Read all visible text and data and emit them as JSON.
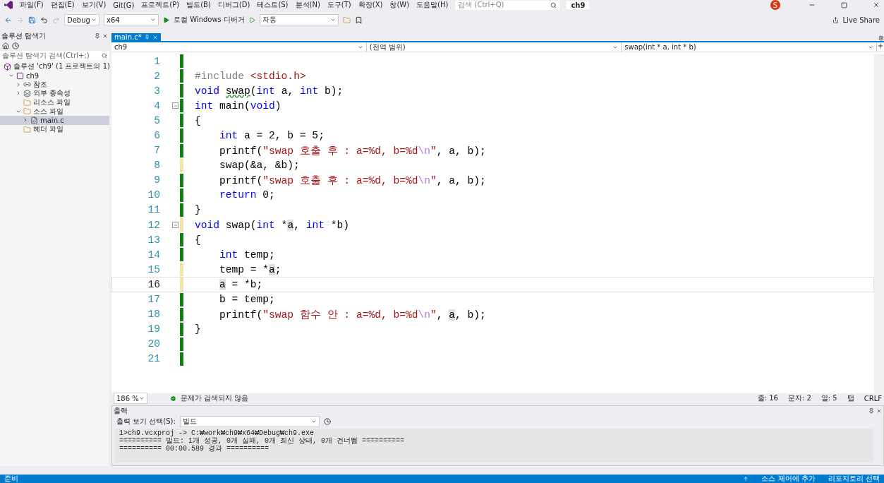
{
  "menu": [
    "파일(F)",
    "편집(E)",
    "보기(V)",
    "Git(G)",
    "프로젝트(P)",
    "빌드(B)",
    "디버그(D)",
    "테스트(S)",
    "분석(N)",
    "도구(T)",
    "확장(X)",
    "창(W)",
    "도움말(H)"
  ],
  "search": {
    "placeholder": "검색 (Ctrl+Q)"
  },
  "solution_name": "ch9",
  "avatar": "S",
  "toolbar": {
    "configuration": "Debug",
    "platform": "x64",
    "run_label": "로컬 Windows 디버거",
    "solution_config": "자동",
    "live_share": "Live Share"
  },
  "solution_explorer": {
    "title": "솔루션 탐색기",
    "search_placeholder": "솔루션 탐색기 검색(Ctrl+;)",
    "tree": [
      {
        "label": "솔루션 'ch9' (1 프로젝트의 1)",
        "kind": "solution",
        "selected": false,
        "children": [
          {
            "label": "ch9",
            "kind": "project",
            "expanded": true,
            "selected": false,
            "children": [
              {
                "label": "참조",
                "kind": "refs",
                "expanded": false,
                "selected": false
              },
              {
                "label": "외부 종속성",
                "kind": "deps",
                "expanded": false,
                "selected": false
              },
              {
                "label": "리소스 파일",
                "kind": "folder",
                "selected": false
              },
              {
                "label": "소스 파일",
                "kind": "folder",
                "expanded": true,
                "selected": false,
                "children": [
                  {
                    "label": "main.c",
                    "kind": "file",
                    "expanded": false,
                    "selected": true
                  }
                ]
              },
              {
                "label": "헤더 파일",
                "kind": "folder",
                "selected": false
              }
            ]
          }
        ]
      }
    ]
  },
  "editor": {
    "tab": "main.c*",
    "nav": [
      "ch9",
      "(전역 범위)",
      "swap(int * a, int * b)"
    ],
    "lines": [
      {
        "number": "1",
        "modified": false,
        "current": false,
        "fold": false
      },
      {
        "number": "2",
        "modified": false,
        "current": false,
        "fold": false,
        "indented": false,
        "tokens": [
          {
            "kind": "pp",
            "text": "#include "
          },
          {
            "kind": "string",
            "text": "<stdio.h>"
          }
        ]
      },
      {
        "number": "3",
        "modified": false,
        "current": false,
        "fold": false,
        "indented": false,
        "tokens": [
          {
            "kind": "keyword",
            "text": "void "
          },
          {
            "kind": "warn",
            "text": "swap"
          },
          {
            "kind": "plain",
            "text": "("
          },
          {
            "kind": "keyword",
            "text": "int"
          },
          {
            "kind": "plain",
            "text": " a, "
          },
          {
            "kind": "keyword",
            "text": "int"
          },
          {
            "kind": "plain",
            "text": " b);"
          }
        ]
      },
      {
        "number": "4",
        "modified": false,
        "current": false,
        "fold": true,
        "indented": false,
        "tokens": [
          {
            "kind": "keyword",
            "text": "int"
          },
          {
            "kind": "plain",
            "text": " main("
          },
          {
            "kind": "keyword",
            "text": "void"
          },
          {
            "kind": "plain",
            "text": ")"
          }
        ]
      },
      {
        "number": "5",
        "modified": false,
        "current": false,
        "fold": false,
        "indented": false,
        "tokens": [
          {
            "kind": "plain",
            "text": "{"
          }
        ]
      },
      {
        "number": "6",
        "modified": false,
        "current": false,
        "fold": false,
        "indented": true,
        "tokens": [
          {
            "kind": "keyword",
            "text": "int"
          },
          {
            "kind": "plain",
            "text": " a = 2, b = 5;"
          }
        ]
      },
      {
        "number": "7",
        "modified": false,
        "current": false,
        "fold": false,
        "indented": true,
        "tokens": [
          {
            "kind": "plain",
            "text": "printf("
          },
          {
            "kind": "string",
            "text": "\"swap 호출 후 : a=%d, b=%d"
          },
          {
            "kind": "escape",
            "text": "\\n"
          },
          {
            "kind": "string",
            "text": "\""
          },
          {
            "kind": "plain",
            "text": ", a, b);"
          }
        ]
      },
      {
        "number": "8",
        "modified": true,
        "current": false,
        "fold": false,
        "indented": true,
        "tokens": [
          {
            "kind": "plain",
            "text": "swap(&a, &b);"
          }
        ]
      },
      {
        "number": "9",
        "modified": false,
        "current": false,
        "fold": false,
        "indented": true,
        "tokens": [
          {
            "kind": "plain",
            "text": "printf("
          },
          {
            "kind": "string",
            "text": "\"swap 호출 후 : a=%d, b=%d"
          },
          {
            "kind": "escape",
            "text": "\\n"
          },
          {
            "kind": "string",
            "text": "\""
          },
          {
            "kind": "plain",
            "text": ", a, b);"
          }
        ]
      },
      {
        "number": "10",
        "modified": false,
        "current": false,
        "fold": false,
        "indented": true,
        "tokens": [
          {
            "kind": "keyword",
            "text": "return"
          },
          {
            "kind": "plain",
            "text": " 0;"
          }
        ]
      },
      {
        "number": "11",
        "modified": false,
        "current": false,
        "fold": false,
        "indented": false,
        "tokens": [
          {
            "kind": "plain",
            "text": "}"
          }
        ]
      },
      {
        "number": "12",
        "modified": true,
        "current": false,
        "fold": true,
        "indented": false,
        "tokens": [
          {
            "kind": "keyword",
            "text": "void"
          },
          {
            "kind": "plain",
            "text": " swap("
          },
          {
            "kind": "keyword",
            "text": "int"
          },
          {
            "kind": "plain",
            "text": " *"
          },
          {
            "kind": "ref",
            "text": "a"
          },
          {
            "kind": "plain",
            "text": ", "
          },
          {
            "kind": "keyword",
            "text": "int"
          },
          {
            "kind": "plain",
            "text": " *b)"
          }
        ]
      },
      {
        "number": "13",
        "modified": false,
        "current": false,
        "fold": false,
        "indented": false,
        "tokens": [
          {
            "kind": "plain",
            "text": "{"
          }
        ]
      },
      {
        "number": "14",
        "modified": false,
        "current": false,
        "fold": false,
        "indented": true,
        "tokens": [
          {
            "kind": "keyword",
            "text": "int"
          },
          {
            "kind": "plain",
            "text": " temp;"
          }
        ]
      },
      {
        "number": "15",
        "modified": true,
        "current": false,
        "fold": false,
        "indented": true,
        "tokens": [
          {
            "kind": "plain",
            "text": "temp = *"
          },
          {
            "kind": "ref",
            "text": "a"
          },
          {
            "kind": "plain",
            "text": ";"
          }
        ]
      },
      {
        "number": "16",
        "modified": true,
        "current": true,
        "fold": false,
        "indented": true,
        "tokens": [
          {
            "kind": "ref",
            "text": "a"
          },
          {
            "kind": "plain",
            "text": " = *b;"
          }
        ]
      },
      {
        "number": "17",
        "modified": false,
        "current": false,
        "fold": false,
        "indented": true,
        "tokens": [
          {
            "kind": "plain",
            "text": "b = temp;"
          }
        ]
      },
      {
        "number": "18",
        "modified": false,
        "current": false,
        "fold": false,
        "indented": true,
        "tokens": [
          {
            "kind": "plain",
            "text": "printf("
          },
          {
            "kind": "string",
            "text": "\"swap 함수 안 : a=%d, b=%d"
          },
          {
            "kind": "escape",
            "text": "\\n"
          },
          {
            "kind": "string",
            "text": "\""
          },
          {
            "kind": "plain",
            "text": ", "
          },
          {
            "kind": "ref",
            "text": "a"
          },
          {
            "kind": "plain",
            "text": ", b);"
          }
        ]
      },
      {
        "number": "19",
        "modified": false,
        "current": false,
        "fold": false,
        "indented": false,
        "tokens": [
          {
            "kind": "plain",
            "text": "}"
          }
        ]
      },
      {
        "number": "20",
        "modified": false,
        "current": false,
        "fold": false
      },
      {
        "number": "21",
        "modified": false,
        "current": false,
        "fold": false
      }
    ],
    "zoom": "186 %",
    "issues": "문제가 검색되지 않음",
    "position": [
      "줄: 16",
      "문자: 2",
      "열: 5",
      "탭",
      "CRLF"
    ]
  },
  "output": {
    "title": "출력",
    "source_label": "출력 보기 선택(S):",
    "source": "빌드",
    "lines": [
      "1>ch9.vcxproj -> C:₩work₩ch9₩x64₩Debug₩ch9.exe",
      "========== 빌드: 1개 성공, 0개 실패, 0개 최신 상태, 0개 건너뜀 ==========",
      "========== 00:00.589 경과 =========="
    ]
  },
  "status_bar": {
    "left": "준비",
    "source_control": "소스 제어에 추가",
    "repository": "리포지토리 선택"
  }
}
